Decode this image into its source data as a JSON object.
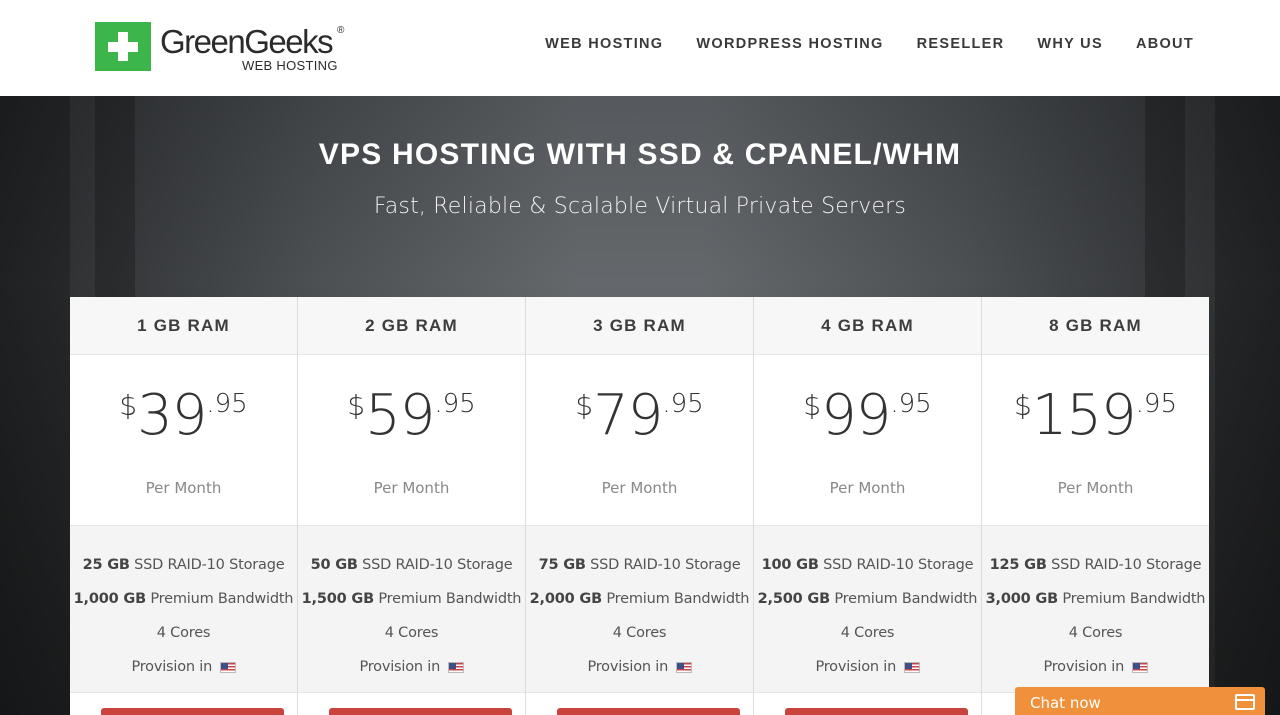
{
  "header": {
    "logo_name": "GreenGeeks",
    "logo_reg": "®",
    "logo_sub": "WEB HOSTING",
    "nav": [
      "WEB HOSTING",
      "WORDPRESS HOSTING",
      "RESELLER",
      "WHY US",
      "ABOUT"
    ]
  },
  "hero": {
    "title": "VPS HOSTING WITH SSD & CPANEL/WHM",
    "subtitle": "Fast, Reliable & Scalable Virtual Private Servers"
  },
  "plans": [
    {
      "name": "1 GB RAM",
      "currency": "$",
      "amount": "39",
      "cents": ".95",
      "period": "Per Month",
      "storage_val": "25 GB",
      "storage_label": "SSD RAID-10 Storage",
      "bw_val": "1,000 GB",
      "bw_label": "Premium Bandwidth",
      "cores": "4 Cores",
      "provision": "Provision in"
    },
    {
      "name": "2 GB RAM",
      "currency": "$",
      "amount": "59",
      "cents": ".95",
      "period": "Per Month",
      "storage_val": "50 GB",
      "storage_label": "SSD RAID-10 Storage",
      "bw_val": "1,500 GB",
      "bw_label": "Premium Bandwidth",
      "cores": "4 Cores",
      "provision": "Provision in"
    },
    {
      "name": "3 GB RAM",
      "currency": "$",
      "amount": "79",
      "cents": ".95",
      "period": "Per Month",
      "storage_val": "75 GB",
      "storage_label": "SSD RAID-10 Storage",
      "bw_val": "2,000 GB",
      "bw_label": "Premium Bandwidth",
      "cores": "4 Cores",
      "provision": "Provision in"
    },
    {
      "name": "4 GB RAM",
      "currency": "$",
      "amount": "99",
      "cents": ".95",
      "period": "Per Month",
      "storage_val": "100 GB",
      "storage_label": "SSD RAID-10 Storage",
      "bw_val": "2,500 GB",
      "bw_label": "Premium Bandwidth",
      "cores": "4 Cores",
      "provision": "Provision in"
    },
    {
      "name": "8 GB RAM",
      "currency": "$",
      "amount": "159",
      "cents": ".95",
      "period": "Per Month",
      "storage_val": "125 GB",
      "storage_label": "SSD RAID-10 Storage",
      "bw_val": "3,000 GB",
      "bw_label": "Premium Bandwidth",
      "cores": "4 Cores",
      "provision": "Provision in"
    }
  ],
  "flag_icon": "us-flag-icon",
  "chat": {
    "label": "Chat now",
    "icon": "chat-window-icon"
  },
  "colors": {
    "brand_green": "#3cb54a",
    "order_red": "#c9423b",
    "chat_orange": "#f0903a"
  }
}
